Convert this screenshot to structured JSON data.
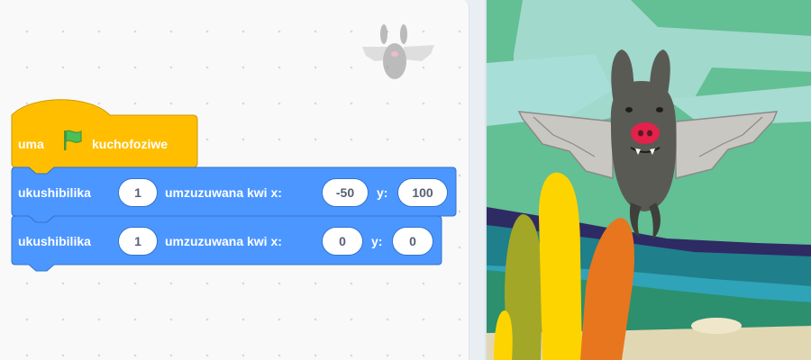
{
  "hat_block": {
    "label_before": "uma",
    "flag_icon": "green-flag-icon",
    "label_after": "kuchofoziwe",
    "color": "#FFBF00"
  },
  "motion_blocks": [
    {
      "label_move": "ukushibilika",
      "secs": "1",
      "label_glide": "umzuzuwana kwi x:",
      "x": "-50",
      "label_y": "y:",
      "y": "100"
    },
    {
      "label_move": "ukushibilika",
      "secs": "1",
      "label_glide": "umzuzuwana kwi x:",
      "x": "0",
      "label_y": "y:",
      "y": "0"
    }
  ],
  "colors": {
    "motion": "#4C97FF",
    "motion_border": "#3373CC",
    "events": "#FFBF00",
    "events_border": "#CC9900"
  },
  "stage": {
    "sprite": "bat-sprite",
    "backdrop": "desert-hills-backdrop"
  }
}
